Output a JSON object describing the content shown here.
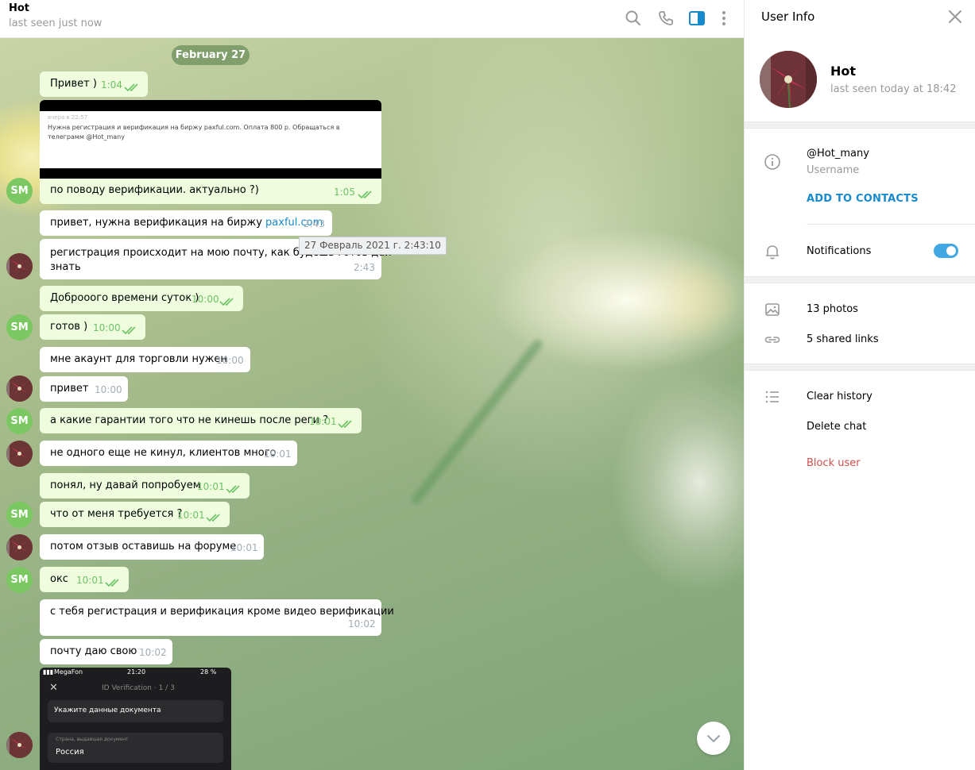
{
  "chat": {
    "title": "Hot",
    "status": "last seen just now",
    "date": "February 27",
    "tooltip": "27 Февраль 2021 г. 2:43:10",
    "image_card": {
      "small": "вчера в 22:57",
      "text": "Нужна регистрация и верификация на биржу paxful.com. Оплата 800 р. Обращаться в телеграмм @Hot_many"
    },
    "messages": [
      {
        "text": "Привет )",
        "time": "1:04",
        "dir": "out"
      },
      {
        "text": "по поводу верификации. актуально ?)",
        "time": "1:05",
        "dir": "out"
      },
      {
        "text": "привет, нужна верификация на биржу ",
        "link": "paxful.com",
        "time": "2:43",
        "dir": "in"
      },
      {
        "text": "регистрация происходит на мою почту, как будешь готов дай",
        "text2": "знать",
        "time": "2:43",
        "dir": "in"
      },
      {
        "text": "Доброоого времени суток )",
        "time": "10:00",
        "dir": "out"
      },
      {
        "text": "готов )",
        "time": "10:00",
        "dir": "out"
      },
      {
        "text": "мне акаунт для торговли нужен",
        "time": "10:00",
        "dir": "in"
      },
      {
        "text": "привет",
        "time": "10:00",
        "dir": "in"
      },
      {
        "text": "а какие гарантии того что не кинешь после реги ?",
        "time": "10:01",
        "dir": "out"
      },
      {
        "text": "не одного еще не кинул, клиентов много",
        "time": "10:01",
        "dir": "in"
      },
      {
        "text": "понял, ну давай попробуем",
        "time": "10:01",
        "dir": "out"
      },
      {
        "text": "что от меня требуется ?",
        "time": "10:01",
        "dir": "out"
      },
      {
        "text": "потом отзыв оставишь на форуме",
        "time": "10:01",
        "dir": "in"
      },
      {
        "text": "окс",
        "time": "10:01",
        "dir": "out"
      },
      {
        "text": "с тебя регистрация и верификация кроме видео верификации",
        "time": "10:02",
        "dir": "in"
      },
      {
        "text": "почту даю свою",
        "time": "10:02",
        "dir": "in"
      }
    ],
    "my_initials": "SM",
    "phone_screenshot": {
      "carrier": "MegaFon",
      "clock": "21:20",
      "battery": "28 %",
      "title": "ID Verification · 1 / 3",
      "field1": "Укажите данные документа",
      "field2_label": "Страна, выдавшая документ",
      "field2_value": "Россия"
    }
  },
  "header_icons": [
    "search-icon",
    "phone-icon",
    "sidebar-toggle-icon",
    "more-vertical-icon"
  ],
  "panel": {
    "title": "User Info",
    "name": "Hot",
    "status": "last seen today at 18:42",
    "username": "@Hot_many",
    "username_label": "Username",
    "add_contacts": "ADD TO CONTACTS",
    "notifications": "Notifications",
    "notifications_on": true,
    "photos": "13 photos",
    "links": "5 shared links",
    "clear_history": "Clear history",
    "delete_chat": "Delete chat",
    "block_user": "Block user"
  },
  "colors": {
    "accent": "#168acd",
    "outgoing_bubble": "#effdde",
    "check_green": "#6cc264",
    "avatar_green": "#7bc862",
    "danger": "#d14e4e"
  }
}
